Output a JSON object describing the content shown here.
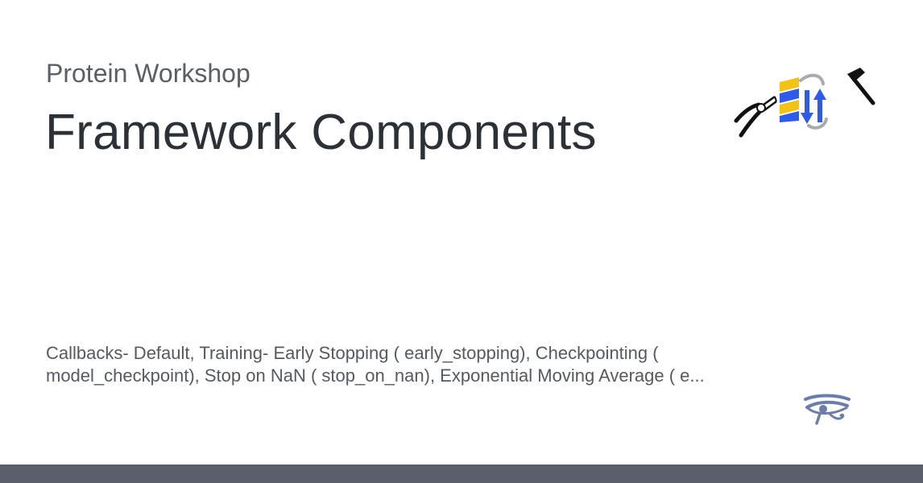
{
  "card": {
    "site_name": "Protein Workshop",
    "title": "Framework Components",
    "description_line1": "Callbacks- Default, Training- Early Stopping ( early_stopping), Checkpointing (",
    "description_line2": "model_checkpoint), Stop on NaN ( stop_on_nan), Exponential Moving Average ( e..."
  },
  "icons": {
    "logo": [
      "pliers-icon",
      "protein-structure-icon",
      "hammer-icon"
    ],
    "site_badge": "eye-of-horus-icon"
  },
  "colors": {
    "title": "#2b3137",
    "subtitle": "#5a5f66",
    "footer": "#5a5f6b",
    "helix_yellow": "#f2c314",
    "helix_blue": "#2f5bea"
  }
}
